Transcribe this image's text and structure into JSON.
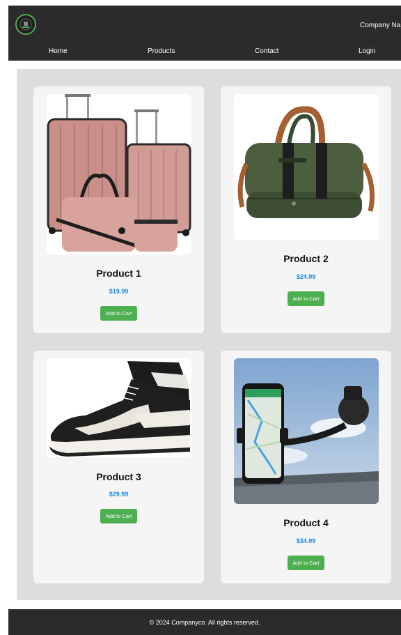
{
  "header": {
    "company_name": "Company Name",
    "logo_icon": "company-logo",
    "nav": [
      {
        "label": "Home"
      },
      {
        "label": "Products"
      },
      {
        "label": "Contact"
      },
      {
        "label": "Login"
      }
    ]
  },
  "products": [
    {
      "title": "Product 1",
      "price": "$19.99",
      "button": "Add to Cart",
      "image_icon": "luggage-set-image"
    },
    {
      "title": "Product 2",
      "price": "$24.99",
      "button": "Add to Cart",
      "image_icon": "duffel-bag-image"
    },
    {
      "title": "Product 3",
      "price": "$29.99",
      "button": "Add to Cart",
      "image_icon": "sneaker-image"
    },
    {
      "title": "Product 4",
      "price": "$34.99",
      "button": "Add to Cart",
      "image_icon": "phone-mount-image"
    }
  ],
  "footer": {
    "text": "© 2024 Companyco. All rights reserved."
  },
  "colors": {
    "header_bg": "#2b2b2b",
    "accent_green": "#4caf50",
    "price_blue": "#1e88e5",
    "main_bg": "#dddddd",
    "card_bg": "#f5f5f5"
  }
}
